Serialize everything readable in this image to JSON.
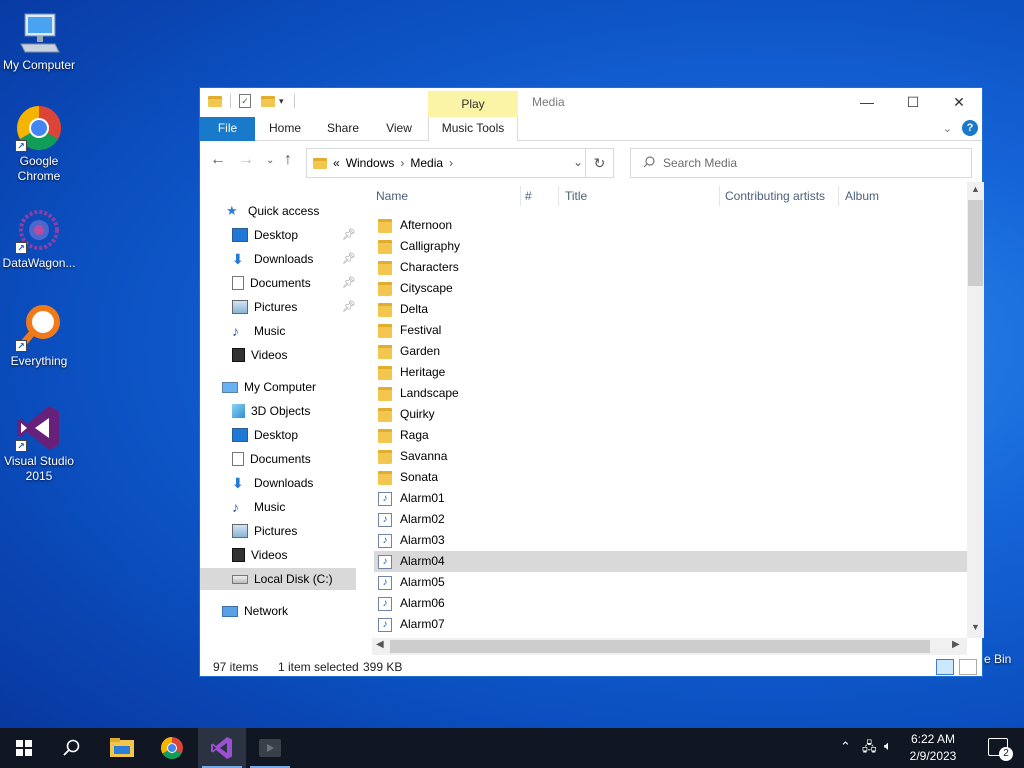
{
  "desktop": {
    "icons": [
      {
        "label": "My Computer",
        "icon": "computer-icon"
      },
      {
        "label": "Google Chrome",
        "icon": "chrome-icon"
      },
      {
        "label": "DataWagon...",
        "icon": "datawagon-icon"
      },
      {
        "label": "Everything",
        "icon": "everything-search-icon"
      },
      {
        "label": "Visual Studio 2015",
        "icon": "visual-studio-icon"
      }
    ],
    "recycle_bin_label": "e Bin"
  },
  "window": {
    "title": "Media",
    "contextual_tab_group": "Play",
    "ribbon_tabs": [
      "File",
      "Home",
      "Share",
      "View",
      "Music Tools"
    ],
    "address": {
      "overflow": "«",
      "segments": [
        "Windows",
        "Media"
      ]
    },
    "search_placeholder": "Search Media",
    "columns": [
      "Name",
      "#",
      "Title",
      "Contributing artists",
      "Album"
    ],
    "nav_pane": {
      "quick_access": {
        "label": "Quick access",
        "items": [
          {
            "label": "Desktop",
            "pinned": true
          },
          {
            "label": "Downloads",
            "pinned": true
          },
          {
            "label": "Documents",
            "pinned": true
          },
          {
            "label": "Pictures",
            "pinned": true
          },
          {
            "label": "Music",
            "pinned": false
          },
          {
            "label": "Videos",
            "pinned": false
          }
        ]
      },
      "this_pc": {
        "label": "My Computer",
        "items": [
          "3D Objects",
          "Desktop",
          "Documents",
          "Downloads",
          "Music",
          "Pictures",
          "Videos",
          "Local Disk (C:)"
        ]
      },
      "network": "Network",
      "selected": "Local Disk (C:)"
    },
    "files": [
      {
        "name": "Afternoon",
        "type": "folder"
      },
      {
        "name": "Calligraphy",
        "type": "folder"
      },
      {
        "name": "Characters",
        "type": "folder"
      },
      {
        "name": "Cityscape",
        "type": "folder"
      },
      {
        "name": "Delta",
        "type": "folder"
      },
      {
        "name": "Festival",
        "type": "folder"
      },
      {
        "name": "Garden",
        "type": "folder"
      },
      {
        "name": "Heritage",
        "type": "folder"
      },
      {
        "name": "Landscape",
        "type": "folder"
      },
      {
        "name": "Quirky",
        "type": "folder"
      },
      {
        "name": "Raga",
        "type": "folder"
      },
      {
        "name": "Savanna",
        "type": "folder"
      },
      {
        "name": "Sonata",
        "type": "folder"
      },
      {
        "name": "Alarm01",
        "type": "audio"
      },
      {
        "name": "Alarm02",
        "type": "audio"
      },
      {
        "name": "Alarm03",
        "type": "audio"
      },
      {
        "name": "Alarm04",
        "type": "audio",
        "selected": true
      },
      {
        "name": "Alarm05",
        "type": "audio"
      },
      {
        "name": "Alarm06",
        "type": "audio"
      },
      {
        "name": "Alarm07",
        "type": "audio"
      }
    ],
    "status": {
      "count": "97 items",
      "selection": "1 item selected",
      "size": "399 KB"
    }
  },
  "taskbar": {
    "apps": [
      "start-icon",
      "search-icon",
      "file-explorer-icon",
      "chrome-icon",
      "visual-studio-icon",
      "media-player-icon"
    ],
    "time": "6:22 AM",
    "date": "2/9/2023",
    "notification_count": "2"
  },
  "colors": {
    "accent": "#1979ca",
    "selection": "#d9d9d9",
    "folder": "#f3c74f",
    "taskbar": "#101622"
  }
}
